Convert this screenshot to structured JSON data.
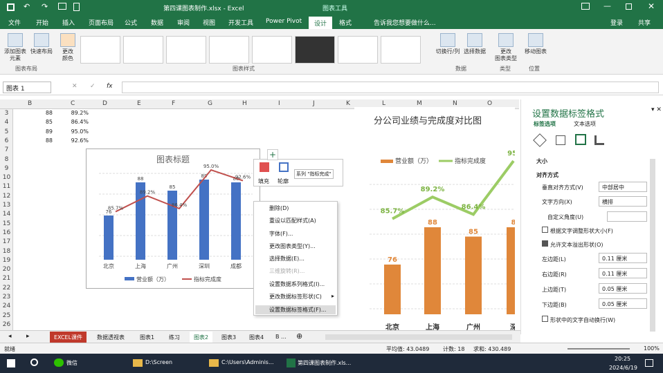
{
  "window": {
    "title": "第四课图表制作.xlsx - Excel",
    "context": "图表工具"
  },
  "tabs": [
    "文件",
    "开始",
    "插入",
    "页面布局",
    "公式",
    "数据",
    "审阅",
    "视图",
    "开发工具",
    "Power Pivot",
    "设计",
    "格式"
  ],
  "tell_me": "告诉我您想要做什么...",
  "account": {
    "login": "登录",
    "share": "共享"
  },
  "ribbon": {
    "add_element": "添加图表\n元素",
    "quick_layout": "快速布局",
    "change_color": "更改\n颜色",
    "group_layout": "图表布局",
    "group_styles": "图表样式",
    "switch_rowcol": "切换行/列",
    "select_data": "选择数据",
    "group_data": "数据",
    "change_type": "更改\n图表类型",
    "group_type": "类型",
    "move_chart": "移动图表",
    "group_location": "位置"
  },
  "namebox": "图表 1",
  "fx": "fx",
  "columns": [
    "B",
    "C",
    "D",
    "E",
    "F",
    "G",
    "H",
    "I",
    "J",
    "K",
    "L",
    "M",
    "N",
    "O"
  ],
  "rows": [
    "3",
    "4",
    "5",
    "6",
    "7",
    "8",
    "9",
    "10",
    "11",
    "12",
    "13",
    "14",
    "15",
    "16",
    "17",
    "18",
    "19",
    "20",
    "21",
    "22",
    "23",
    "24",
    "25",
    "26"
  ],
  "cells": [
    [
      "88",
      "89.2%"
    ],
    [
      "85",
      "86.4%"
    ],
    [
      "89",
      "95.0%"
    ],
    [
      "88",
      "92.6%"
    ]
  ],
  "chart_data": [
    {
      "type": "bar",
      "title": "图表标题",
      "categories": [
        "北京",
        "上海",
        "广州",
        "深圳",
        "成都"
      ],
      "series": [
        {
          "name": "营业额（万）",
          "values": [
            76,
            88,
            85,
            89,
            88
          ]
        },
        {
          "name": "指标完成度",
          "values": [
            85.7,
            89.2,
            86.4,
            95.0,
            92.6
          ]
        }
      ],
      "data_labels_bar": [
        "76",
        "88",
        "85",
        "89",
        "88"
      ],
      "data_labels_line": [
        "85.7%",
        "89.2%",
        "86.4%",
        "95.0%",
        "92.6%"
      ],
      "legend": "bottom",
      "colors": [
        "#4472c4",
        "#c0504d"
      ]
    },
    {
      "type": "bar",
      "title": "分公司业绩与完成度对比图",
      "categories": [
        "北京",
        "上海",
        "广州",
        "深"
      ],
      "series": [
        {
          "name": "营业额（万）",
          "values": [
            76,
            88,
            85
          ]
        },
        {
          "name": "指标完成度",
          "values": [
            85.7,
            89.2,
            86.4,
            95
          ]
        }
      ],
      "data_labels_bar": [
        "76",
        "88",
        "85",
        "8"
      ],
      "data_labels_line": [
        "85.7%",
        "89.2%",
        "86.4%",
        "95."
      ],
      "legend": "top",
      "colors": [
        "#e0873a",
        "#9ccc65"
      ]
    }
  ],
  "mini_toolbar": {
    "fill": "填充",
    "outline": "轮廓",
    "series": "系列 \"指标完成\""
  },
  "context_menu": [
    {
      "label": "删除(D)",
      "disabled": false
    },
    {
      "label": "重设以匹配样式(A)",
      "disabled": false
    },
    {
      "label": "字体(F)...",
      "disabled": false
    },
    {
      "label": "更改图表类型(Y)...",
      "disabled": false
    },
    {
      "label": "选择数据(E)...",
      "disabled": false
    },
    {
      "label": "三维旋转(R)...",
      "disabled": true
    },
    {
      "label": "设置数据系列格式(I)...",
      "disabled": false
    },
    {
      "label": "更改数据标签形状(C)",
      "disabled": false
    },
    {
      "label": "设置数据标签格式(F)...",
      "disabled": false
    }
  ],
  "pane": {
    "title": "设置数据标签格式",
    "tab1": "标签选项",
    "tab2": "文本选项",
    "size": "大小",
    "align": "对齐方式",
    "valign_label": "垂直对齐方式(V)",
    "valign_value": "中部居中",
    "textdir_label": "文字方向(X)",
    "textdir_value": "横排",
    "angle_label": "自定义角度(U)",
    "autofit": "根据文字调整形状大小(F)",
    "overflow": "允许文本溢出形状(O)",
    "left_label": "左边距(L)",
    "left_value": "0.11 厘米",
    "right_label": "右边距(R)",
    "right_value": "0.11 厘米",
    "top_label": "上边距(T)",
    "top_value": "0.05 厘米",
    "bottom_label": "下边距(B)",
    "bottom_value": "0.05 厘米",
    "wrap": "形状中的文字自动换行(W)"
  },
  "sheets": [
    "EXCEL课件",
    "数据透视表",
    "图表1",
    "练习",
    "图表2",
    "图表3",
    "图表4",
    "B ..."
  ],
  "status": {
    "ready": "就绪",
    "avg": "平均值: 43.0489",
    "count": "计数: 18",
    "sum": "求和: 430.489",
    "zoom": "100%"
  },
  "taskbar": {
    "wechat": "微信",
    "folder": "D:\\Screen",
    "path": "C:\\Users\\Adminis...",
    "excel": "第四课图表制作.xls...",
    "time": "20:25",
    "date": "2024/6/19"
  }
}
